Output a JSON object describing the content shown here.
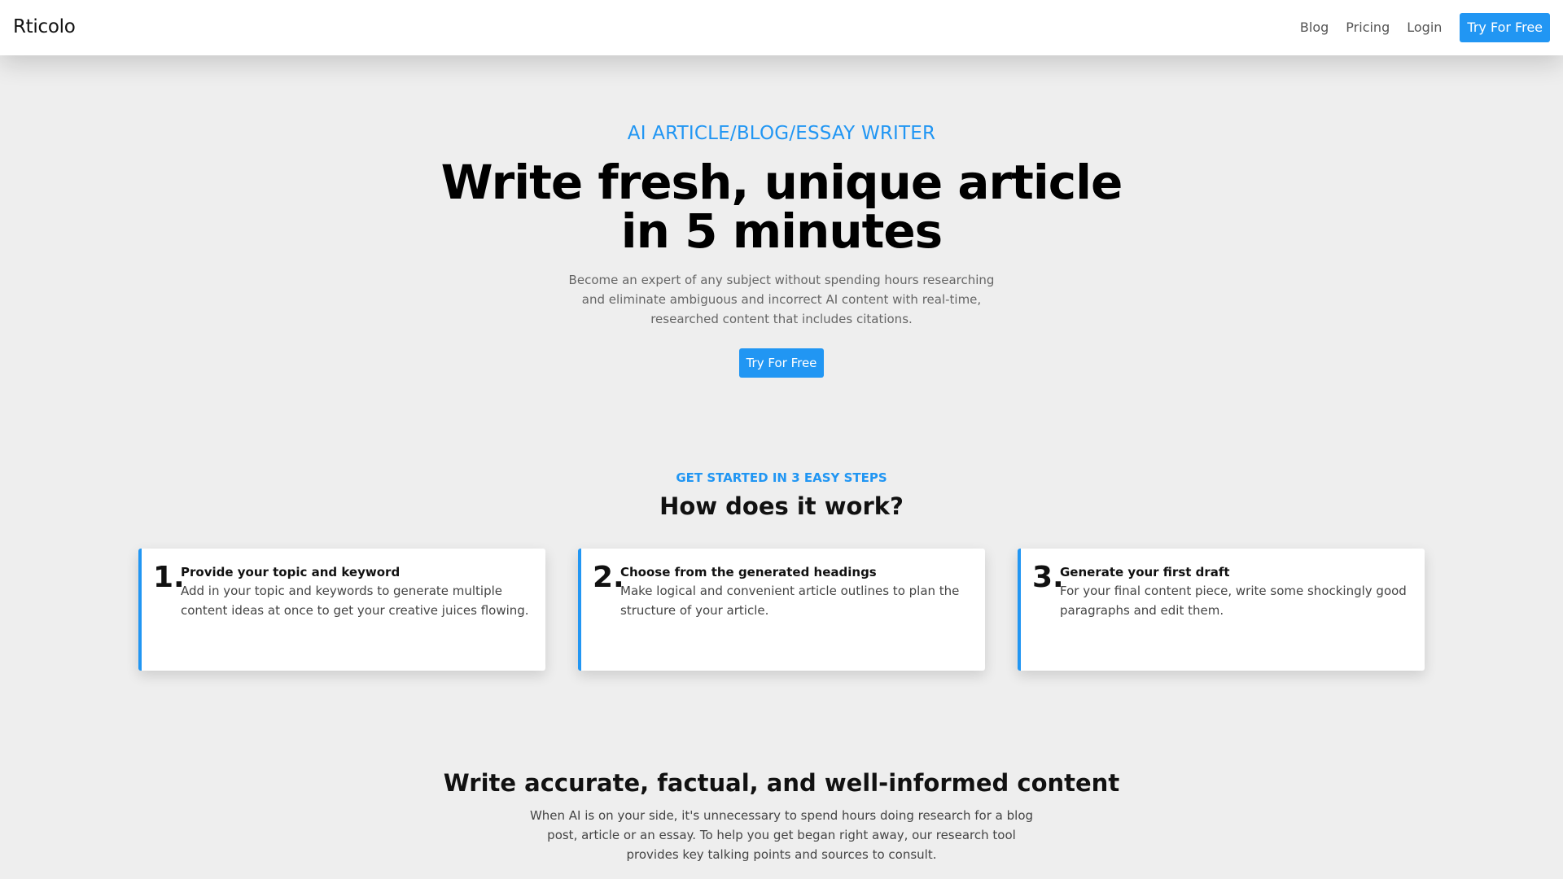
{
  "header": {
    "brand": "Rticolo",
    "nav": {
      "blog": "Blog",
      "pricing": "Pricing",
      "login": "Login",
      "cta": "Try For Free"
    }
  },
  "hero": {
    "eyebrow": "AI ARTICLE/BLOG/ESSAY WRITER",
    "title_line1": "Write fresh, unique article",
    "title_line2": "in 5 minutes",
    "subtitle": "Become an expert of any subject without spending hours researching and eliminate ambiguous and incorrect AI content with real-time, researched content that includes citations.",
    "cta": "Try For Free"
  },
  "steps": {
    "eyebrow": "GET STARTED IN 3 EASY STEPS",
    "title": "How does it work?",
    "items": [
      {
        "number": "1.",
        "title": "Provide your topic and keyword",
        "text": "Add in your topic and keywords to generate multiple content ideas at once to get your creative juices flowing."
      },
      {
        "number": "2.",
        "title": "Choose from the generated headings",
        "text": "Make logical and convenient article outlines to plan the structure of your article."
      },
      {
        "number": "3.",
        "title": "Generate your first draft",
        "text": "For your final content piece, write some shockingly good paragraphs and edit them."
      }
    ]
  },
  "accuracy": {
    "title": "Write accurate, factual, and well-informed content",
    "text": "When AI is on your side, it's unnecessary to spend hours doing research for a blog post, article or an essay. To help you get began right away, our research tool provides key talking points and sources to consult."
  },
  "colors": {
    "accent": "#2196f3",
    "background": "#eeeeee"
  }
}
